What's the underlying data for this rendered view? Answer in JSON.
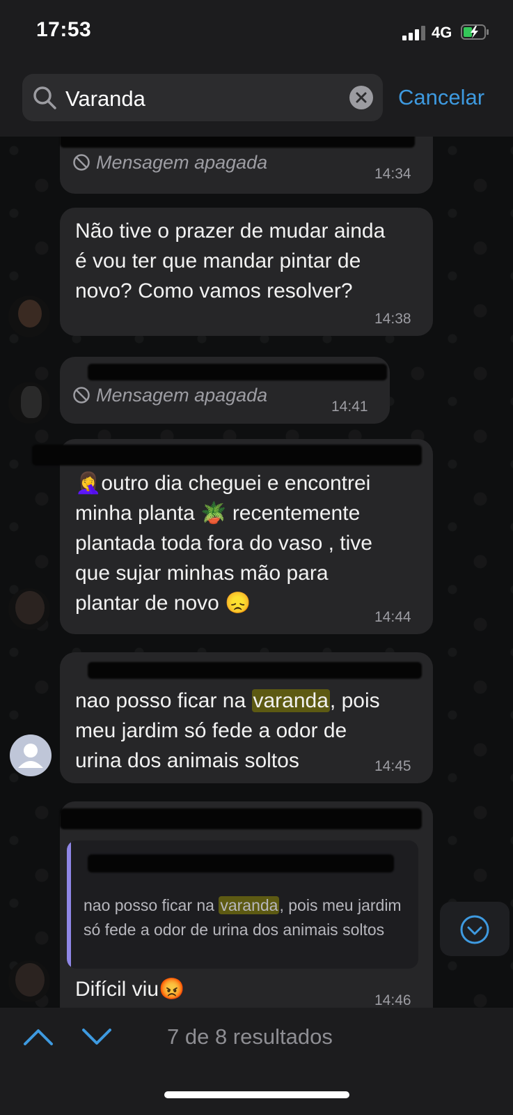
{
  "status_bar": {
    "time": "17:53",
    "network": "4G"
  },
  "search": {
    "query": "Varanda",
    "cancel_label": "Cancelar"
  },
  "messages": [
    {
      "deleted_label": "Mensagem apagada",
      "time": "14:34"
    },
    {
      "text": "Não tive o prazer de mudar ainda\né vou ter que mandar pintar de\nnovo? Como vamos resolver?",
      "time": "14:38"
    },
    {
      "deleted_label": "Mensagem apagada",
      "time": "14:41"
    },
    {
      "emoji_start": "🤦‍♀️",
      "line1": "outro dia cheguei e encontrei",
      "line2_pre": "minha planta ",
      "emoji_plant": "🪴",
      "line2_post": " recentemente",
      "line3": "plantada toda fora do vaso , tive",
      "line4": "que sujar minhas mão para",
      "line5_pre": "plantar de novo ",
      "emoji_sad": "😞",
      "time": "14:44"
    },
    {
      "pre": "nao posso ficar na ",
      "highlight": "varanda",
      "post_line1": ", pois",
      "line2": "meu jardim só fede a odor de",
      "line3": "urina dos animais soltos",
      "time": "14:45"
    },
    {
      "quote_pre": "nao posso ficar na ",
      "quote_highlight": "varanda",
      "quote_post": ", pois meu jardim só fede a odor de urina dos animais soltos",
      "text": "Difícil viu",
      "emoji_angry": "😡",
      "time": "14:46"
    }
  ],
  "footer": {
    "results_text": "7 de 8 resultados"
  },
  "colors": {
    "accent": "#3e9ae0",
    "highlight": "#5d5a13",
    "quote_bar": "#8f87e6",
    "bubble": "#262628"
  },
  "icons": [
    "search-icon",
    "clear-icon",
    "deleted-icon",
    "chevron-up-icon",
    "chevron-down-icon",
    "scroll-down-icon",
    "battery-icon",
    "signal-icon"
  ]
}
